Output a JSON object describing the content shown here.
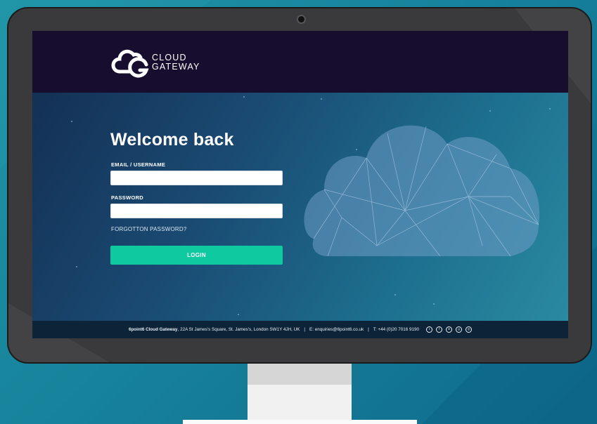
{
  "brand": {
    "logo_icon": "cloud-g-logo",
    "line1": "CLOUD",
    "line2": "GATEWAY"
  },
  "login": {
    "title": "Welcome back",
    "email_label": "EMAIL / USERNAME",
    "email_value": "",
    "password_label": "PASSWORD",
    "password_value": "",
    "forgot_label": "FORGOTTON PASSWORD?",
    "login_button": "LOGIN"
  },
  "footer": {
    "company": "6point6 Cloud Gateway",
    "address": ", 22A St James's Square, St. James's, London SW1Y 4JH, UK",
    "sep1": "|",
    "email": "E: enquiries@6point6.co.uk",
    "sep2": "|",
    "phone": "T: +44 (0)20 7016 9190",
    "social_icons": [
      "twitter-icon",
      "facebook-icon",
      "linkedin-icon",
      "google-plus-icon",
      "instagram-icon"
    ]
  },
  "colors": {
    "header_bg": "#170d2e",
    "accent_button": "#0fc9a0",
    "footer_bg": "#0c2338",
    "page_bg": "#1a88a0"
  }
}
